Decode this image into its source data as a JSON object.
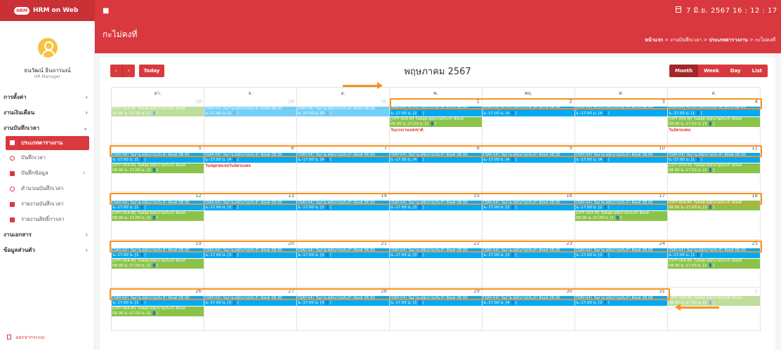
{
  "app": {
    "logo_text": "HRM",
    "title": "HRM on Web",
    "datetime": "7 มิ.ย. 2567  16 : 12 : 17",
    "accent": "#d9393e"
  },
  "user": {
    "name": "ธนวัฒน์ ธินจารมณ์",
    "role": "HR Manager"
  },
  "sidebar": {
    "items": [
      {
        "label": "การตั้งค่า",
        "caret": "›"
      },
      {
        "label": "งานเงินเดือน",
        "caret": "›"
      },
      {
        "label": "งานบันทึกเวลา",
        "caret": "⌄"
      }
    ],
    "sub_items": [
      {
        "label": "ประเภทตารางงาน",
        "icon": "table-icon",
        "active": true
      },
      {
        "label": "บันทึกเวลา",
        "icon": "clock-icon"
      },
      {
        "label": "บันทึกข้อมูล",
        "icon": "file-icon",
        "caret": "›"
      },
      {
        "label": "คำนวณบันทึกเวลา",
        "icon": "clock-icon"
      },
      {
        "label": "รายงานบันทึกเวลา",
        "icon": "file-icon"
      },
      {
        "label": "รายงานสิทธิ์การลา",
        "icon": "chart-icon"
      }
    ],
    "items_bottom": [
      {
        "label": "งานเอกสาร",
        "caret": "›"
      },
      {
        "label": "ข้อมูลส่วนตัว",
        "caret": "›"
      }
    ],
    "logout": "ออกจากระบบ"
  },
  "header": {
    "title": "กะไม่คงที่",
    "breadcrumb": {
      "home": "หน้าแรก",
      "sep": " > ",
      "level1": "งานบันทึกเวลา",
      "level2": "ประเภทตารางงาน",
      "current": "กะไม่คงที่"
    }
  },
  "calendar": {
    "prev_label": "‹",
    "next_label": "›",
    "today_label": "Today",
    "title": "พฤษภาคม 2567",
    "views": [
      "Month",
      "Week",
      "Day",
      "List"
    ],
    "weekdays": [
      "อา.",
      "จ.",
      "อ.",
      "พ.",
      "พฤ.",
      "ศ.",
      "ส."
    ],
    "weeks": [
      [
        "28",
        "29",
        "30",
        "1",
        "2",
        "3",
        "4"
      ],
      [
        "5",
        "6",
        "7",
        "8",
        "9",
        "10",
        "11"
      ],
      [
        "12",
        "13",
        "14",
        "15",
        "16",
        "17",
        "18"
      ],
      [
        "19",
        "20",
        "21",
        "22",
        "23",
        "24",
        "25"
      ],
      [
        "26",
        "27",
        "28",
        "29",
        "30",
        "31",
        "1"
      ]
    ],
    "event_day_line": "[DAY-04] วันงาน.พนักงานประจำ ตั้งแต่ 08.00",
    "event_off_line": "[OFF-004-M] วันหยุด.พนักงานประจำ ตั้งแต่",
    "time_1": "น.-17.00 น. [1 👤]",
    "time_2": "น.-17.00 น. [2 👤]",
    "time_3": "น.-17.00 น. [3 👤]",
    "time_4": "น.-17.00 น. [4 👤]",
    "off_time_1": "08.00 น.-17.00 น. [1 👤]",
    "off_time_2": "08.00 น.-17.00 น. [2 👤]",
    "off_time_3": "08.00 น.-17.00 น. [3 👤]",
    "holiday_labour": "วันแรงงานแห่งชาติ",
    "holiday_coronation": "วันฉัตรมงคล",
    "holiday_substitute": "วันหยุดชดเชยวันฉัตรมงคล"
  }
}
